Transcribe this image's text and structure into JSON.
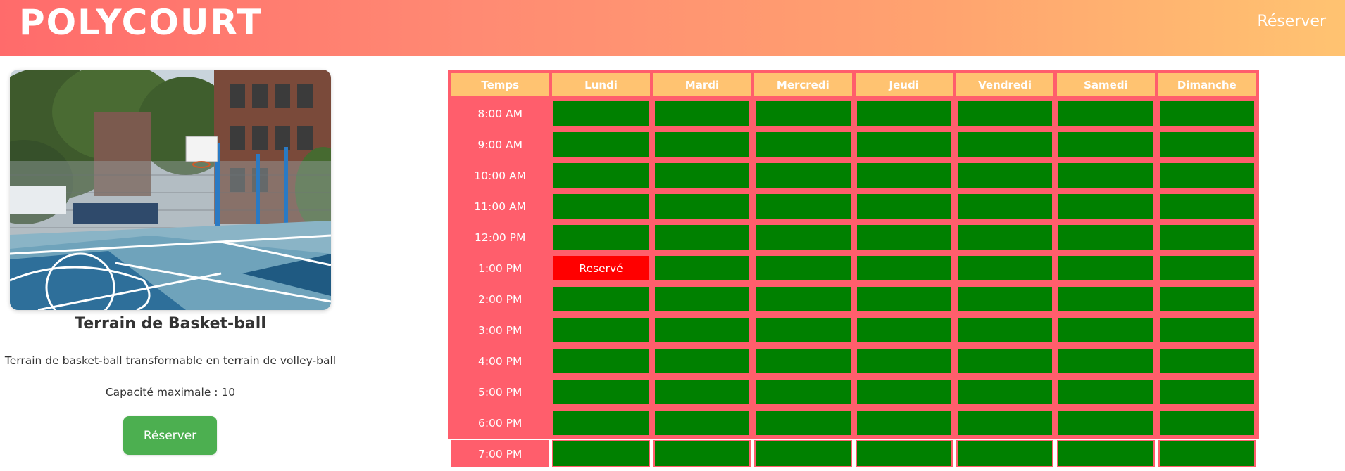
{
  "header": {
    "brand": "POLYCOURT",
    "nav_reserve": "Réserver"
  },
  "court": {
    "image_alt": "basketball-court-photo",
    "title": "Terrain de Basket-ball",
    "description": "Terrain de basket-ball transformable en terrain de volley-ball",
    "capacity": "Capacité maximale : 10",
    "reserve_button": "Réserver"
  },
  "schedule": {
    "columns": [
      "Temps",
      "Lundi",
      "Mardi",
      "Mercredi",
      "Jeudi",
      "Vendredi",
      "Samedi",
      "Dimanche"
    ],
    "rows": [
      {
        "time": "8:00 AM",
        "slots": [
          "",
          "",
          "",
          "",
          "",
          "",
          ""
        ]
      },
      {
        "time": "9:00 AM",
        "slots": [
          "",
          "",
          "",
          "",
          "",
          "",
          ""
        ]
      },
      {
        "time": "10:00 AM",
        "slots": [
          "",
          "",
          "",
          "",
          "",
          "",
          ""
        ]
      },
      {
        "time": "11:00 AM",
        "slots": [
          "",
          "",
          "",
          "",
          "",
          "",
          ""
        ]
      },
      {
        "time": "12:00 PM",
        "slots": [
          "",
          "",
          "",
          "",
          "",
          "",
          ""
        ]
      },
      {
        "time": "1:00 PM",
        "slots": [
          "Reservé",
          "",
          "",
          "",
          "",
          "",
          ""
        ]
      },
      {
        "time": "2:00 PM",
        "slots": [
          "",
          "",
          "",
          "",
          "",
          "",
          ""
        ]
      },
      {
        "time": "3:00 PM",
        "slots": [
          "",
          "",
          "",
          "",
          "",
          "",
          ""
        ]
      },
      {
        "time": "4:00 PM",
        "slots": [
          "",
          "",
          "",
          "",
          "",
          "",
          ""
        ]
      },
      {
        "time": "5:00 PM",
        "slots": [
          "",
          "",
          "",
          "",
          "",
          "",
          ""
        ]
      },
      {
        "time": "6:00 PM",
        "slots": [
          "",
          "",
          "",
          "",
          "",
          "",
          ""
        ]
      },
      {
        "time": "7:00 PM",
        "slots": [
          "",
          "",
          "",
          "",
          "",
          "",
          ""
        ]
      }
    ],
    "colors": {
      "available": "#008000",
      "reserved": "#ff0000",
      "header": "#ffc371",
      "background": "#ff5e6c"
    }
  }
}
